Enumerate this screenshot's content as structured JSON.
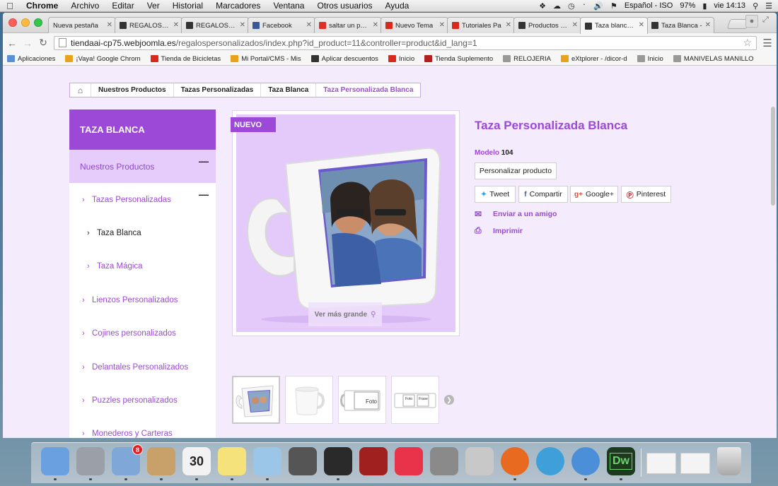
{
  "menubar": {
    "app": "Chrome",
    "items": [
      "Archivo",
      "Editar",
      "Ver",
      "Historial",
      "Marcadores",
      "Ventana",
      "Otros usuarios",
      "Ayuda"
    ],
    "input_source": "Español - ISO",
    "battery": "97%",
    "clock": "vie 14:13"
  },
  "tabs": [
    {
      "title": "Nueva pestaña",
      "color": "#ffffff"
    },
    {
      "title": "REGALOS PER",
      "color": "#333333"
    },
    {
      "title": "REGALOS PER",
      "color": "#333333"
    },
    {
      "title": "Facebook",
      "color": "#3b5998"
    },
    {
      "title": "saltar un paso",
      "color": "#e52d27"
    },
    {
      "title": "Nuevo Tema",
      "color": "#d9291b"
    },
    {
      "title": "Tutoriales Pa",
      "color": "#d9291b"
    },
    {
      "title": "Productos • M",
      "color": "#333333"
    },
    {
      "title": "Taza blanca p",
      "color": "#333333"
    },
    {
      "title": "Taza Blanca -",
      "color": "#333333"
    }
  ],
  "address": {
    "host": "tiendaai-cp75.webjoomla.es",
    "path": "/regalospersonalizados/index.php?id_product=11&controller=product&id_lang=1"
  },
  "bookmarks": [
    {
      "label": "Aplicaciones",
      "color": "#5b8fd6"
    },
    {
      "label": "¡Vaya! Google Chrom",
      "color": "#e8a21c"
    },
    {
      "label": "Tienda de Bicicletas",
      "color": "#d9291b"
    },
    {
      "label": "Mi Portal/CMS - Mis",
      "color": "#e8a21c"
    },
    {
      "label": "Aplicar descuentos",
      "color": "#333333"
    },
    {
      "label": "Inicio",
      "color": "#d9291b"
    },
    {
      "label": "Tienda Suplemento",
      "color": "#b21f1f"
    },
    {
      "label": "RELOJERIA",
      "color": "#999999"
    },
    {
      "label": "eXtplorer - /dicor-d",
      "color": "#e8a21c"
    },
    {
      "label": "Inicio",
      "color": "#999999"
    },
    {
      "label": "MANIVELAS MANILLO",
      "color": "#999999"
    }
  ],
  "breadcrumb": [
    "Nuestros Productos",
    "Tazas Personalizadas",
    "Taza Blanca",
    "Taza Personalizada Blanca"
  ],
  "sidebar": {
    "title": "TAZA BLANCA",
    "top": "Nuestros Productos",
    "items": [
      {
        "label": "Tazas Personalizadas",
        "level": 1
      },
      {
        "label": "Taza Blanca",
        "level": 2,
        "current": true
      },
      {
        "label": "Taza Mágica",
        "level": 2
      },
      {
        "label": "Lienzos Personalizados",
        "level": 1
      },
      {
        "label": "Cojines personalizados",
        "level": 1
      },
      {
        "label": "Delantales Personalizados",
        "level": 1
      },
      {
        "label": "Puzzles personalizados",
        "level": 1
      },
      {
        "label": "Monederos y Carteras",
        "level": 1
      }
    ]
  },
  "product": {
    "badge": "NUEVO",
    "zoom_label": "Ver más grande",
    "name": "Taza Personalizada Blanca",
    "model_label": "Modelo",
    "model_value": "104",
    "customize_button": "Personalizar producto",
    "share": [
      {
        "label": "Tweet",
        "icon": "twitter-icon",
        "color": "#2aa3ef"
      },
      {
        "label": "Compartir",
        "icon": "facebook-icon",
        "color": "#3b5998"
      },
      {
        "label": "Google+",
        "icon": "google-plus-icon",
        "color": "#dd4b39"
      },
      {
        "label": "Pinterest",
        "icon": "pinterest-icon",
        "color": "#cb2027"
      }
    ],
    "send_friend": "Enviar a un amigo",
    "print": "Imprimir"
  },
  "thumbs": {
    "labels": [
      "Foto",
      "Foto",
      "Frase"
    ]
  },
  "colors": {
    "accent": "#9b49d6",
    "page_bg": "#f4ebfc",
    "image_bg": "#e4c9fb"
  },
  "dock": {
    "apps": [
      "Finder",
      "Launchpad",
      "Mail",
      "Contactos",
      "Calendario",
      "Notas",
      "Vista Previa",
      "Photo Booth",
      "Monitor",
      "Photo Booth",
      "iTunes",
      "Preferencias",
      "Utilidad",
      "Firefox",
      "Xcode",
      "Chrome",
      "Dreamweaver"
    ],
    "calendar_day": "30",
    "mail_badge": "8",
    "dreamweaver_label": "Dw"
  }
}
